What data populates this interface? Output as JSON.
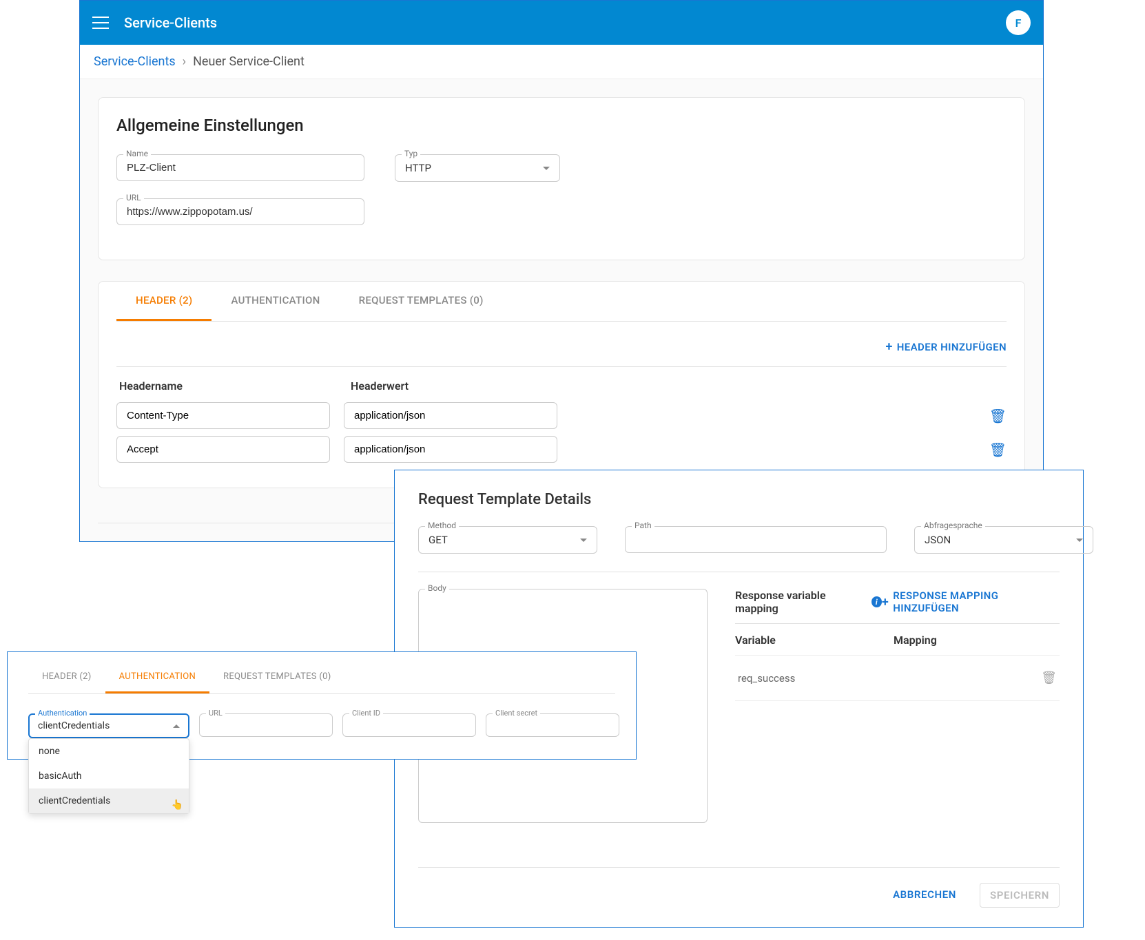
{
  "header": {
    "title": "Service-Clients",
    "avatar_letter": "F"
  },
  "breadcrumb": {
    "root": "Service-Clients",
    "current": "Neuer Service-Client"
  },
  "general": {
    "title": "Allgemeine Einstellungen",
    "name_label": "Name",
    "name_value": "PLZ-Client",
    "type_label": "Typ",
    "type_value": "HTTP",
    "url_label": "URL",
    "url_value": "https://www.zippopotam.us/"
  },
  "tabs": {
    "header": "HEADER (2)",
    "auth": "AUTHENTICATION",
    "templates": "REQUEST TEMPLATES (0)"
  },
  "header_section": {
    "add_button": "HEADER HINZUFÜGEN",
    "col_name": "Headername",
    "col_value": "Headerwert",
    "rows": [
      {
        "name": "Content-Type",
        "value": "application/json"
      },
      {
        "name": "Accept",
        "value": "application/json"
      }
    ]
  },
  "details": {
    "title": "Request Template Details",
    "method_label": "Method",
    "method_value": "GET",
    "path_label": "Path",
    "path_value": "",
    "lang_label": "Abfragesprache",
    "lang_value": "JSON",
    "body_label": "Body",
    "mapping_title": "Response variable mapping",
    "add_mapping": "RESPONSE MAPPING HINZUFÜGEN",
    "col_variable": "Variable",
    "col_mapping": "Mapping",
    "rows": [
      {
        "variable": "req_success",
        "mapping": ""
      }
    ],
    "cancel": "ABBRECHEN",
    "save": "SPEICHERN"
  },
  "auth_panel": {
    "tabs": {
      "header": "HEADER (2)",
      "auth": "AUTHENTICATION",
      "templates": "REQUEST TEMPLATES (0)"
    },
    "auth_label": "Authentication",
    "auth_value": "clientCredentials",
    "url_label": "URL",
    "clientid_label": "Client ID",
    "secret_label": "Client secret",
    "options": [
      "none",
      "basicAuth",
      "clientCredentials"
    ]
  }
}
